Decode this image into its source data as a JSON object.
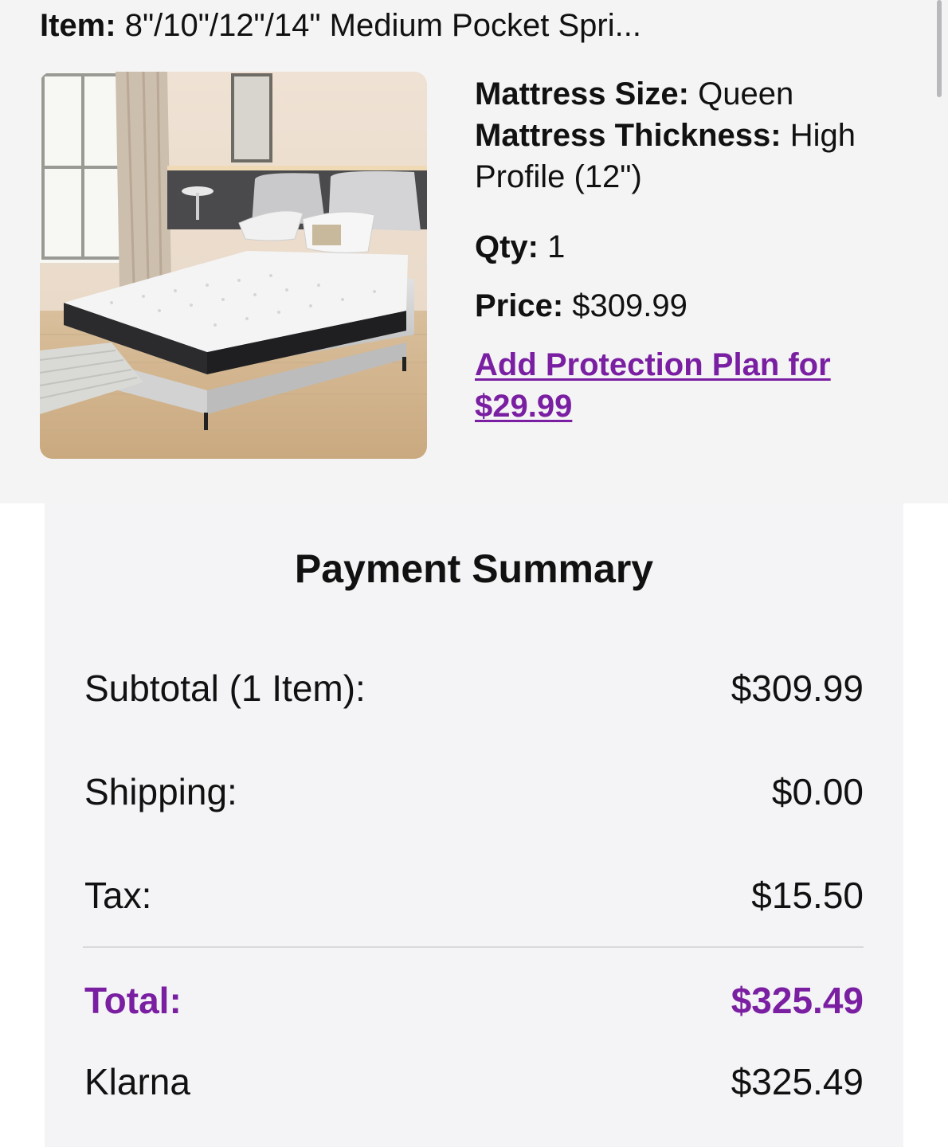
{
  "item": {
    "label": "Item:",
    "name": "8\"/10\"/12\"/14\" Medium Pocket Spri..."
  },
  "image": {
    "description_icon": "mattress-bed-photo"
  },
  "details": {
    "size_label": "Mattress Size:",
    "size_value": "Queen",
    "thickness_label": "Mattress Thickness:",
    "thickness_value": "High Profile (12\")",
    "qty_label": "Qty:",
    "qty_value": "1",
    "price_label": "Price:",
    "price_value": "$309.99",
    "protection_link": "Add Protection Plan for $29.99"
  },
  "summary": {
    "title": "Payment Summary",
    "rows": [
      {
        "label": "Subtotal (1 Item):",
        "value": "$309.99"
      },
      {
        "label": "Shipping:",
        "value": "$0.00"
      },
      {
        "label": "Tax:",
        "value": "$15.50"
      }
    ],
    "total": {
      "label": "Total:",
      "value": "$325.49"
    },
    "payment": {
      "label": "Klarna",
      "value": "$325.49"
    }
  },
  "colors": {
    "accent": "#7a1fa2",
    "section_bg": "#f4f4f5",
    "text": "#111111"
  }
}
